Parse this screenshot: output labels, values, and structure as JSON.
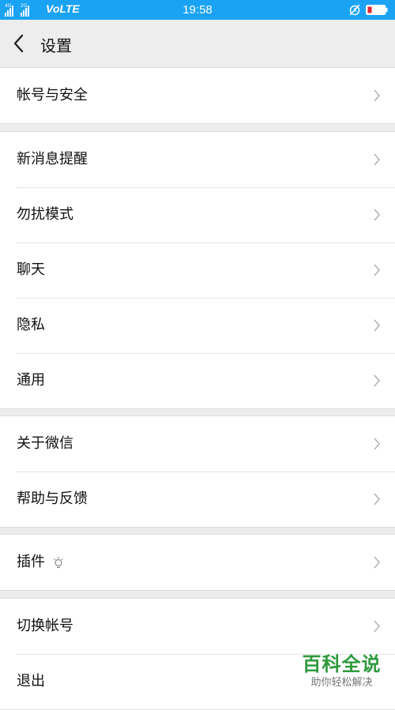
{
  "status_bar": {
    "signal1_tag": "4G",
    "signal2_tag": "2G",
    "network": "VoLTE",
    "time": "19:58",
    "alarm_icon": "alarm-off-icon",
    "battery_color": "#e0262e"
  },
  "header": {
    "title": "设置",
    "back_icon": "chevron-left-icon"
  },
  "groups": [
    {
      "items": [
        {
          "label": "帐号与安全"
        }
      ]
    },
    {
      "items": [
        {
          "label": "新消息提醒"
        },
        {
          "label": "勿扰模式"
        },
        {
          "label": "聊天"
        },
        {
          "label": "隐私"
        },
        {
          "label": "通用"
        }
      ]
    },
    {
      "items": [
        {
          "label": "关于微信"
        },
        {
          "label": "帮助与反馈"
        }
      ]
    },
    {
      "items": [
        {
          "label": "插件"
        }
      ]
    },
    {
      "items": [
        {
          "label": "切换帐号"
        },
        {
          "label": "退出"
        }
      ]
    }
  ],
  "watermark": {
    "title": "百科全说",
    "subtitle": "助你轻松解决"
  },
  "colors": {
    "status_bar": "#1aa3f5",
    "background": "#ededed",
    "watermark": "#2e9a3c"
  }
}
